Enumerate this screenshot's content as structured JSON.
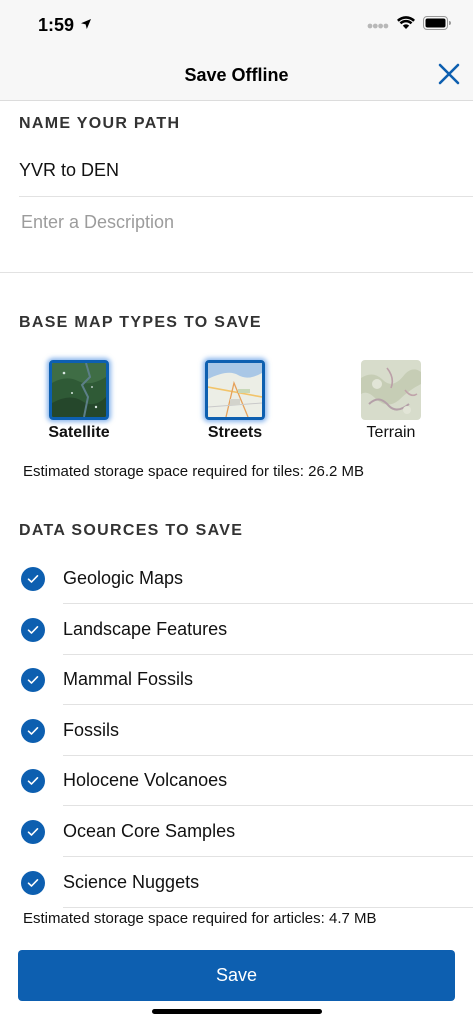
{
  "status_bar": {
    "time": "1:59"
  },
  "nav": {
    "title": "Save Offline"
  },
  "name_section": {
    "header": "NAME YOUR PATH",
    "path_name": "YVR to DEN",
    "description_placeholder": "Enter a Description"
  },
  "map_types": {
    "header": "BASE MAP TYPES TO SAVE",
    "items": [
      {
        "label": "Satellite",
        "selected": true
      },
      {
        "label": "Streets",
        "selected": true
      },
      {
        "label": "Terrain",
        "selected": false
      }
    ],
    "storage_note": "Estimated storage space required for tiles: 26.2 MB"
  },
  "data_sources": {
    "header": "DATA SOURCES TO SAVE",
    "items": [
      {
        "label": "Geologic Maps",
        "checked": true
      },
      {
        "label": "Landscape Features",
        "checked": true
      },
      {
        "label": "Mammal Fossils",
        "checked": true
      },
      {
        "label": "Fossils",
        "checked": true
      },
      {
        "label": "Holocene Volcanoes",
        "checked": true
      },
      {
        "label": "Ocean Core Samples",
        "checked": true
      },
      {
        "label": "Science Nuggets",
        "checked": true
      }
    ],
    "storage_note": "Estimated storage space required for articles: 4.7 MB"
  },
  "footer": {
    "save_label": "Save"
  },
  "colors": {
    "accent": "#0d5fb0",
    "nav_bg": "#f7f7f7",
    "placeholder": "#9c9c9c"
  },
  "icons": {
    "close": "close-icon",
    "check": "checkmark-icon",
    "location": "location-arrow-icon",
    "wifi": "wifi-icon",
    "battery": "battery-icon",
    "signal": "signal-icon"
  }
}
